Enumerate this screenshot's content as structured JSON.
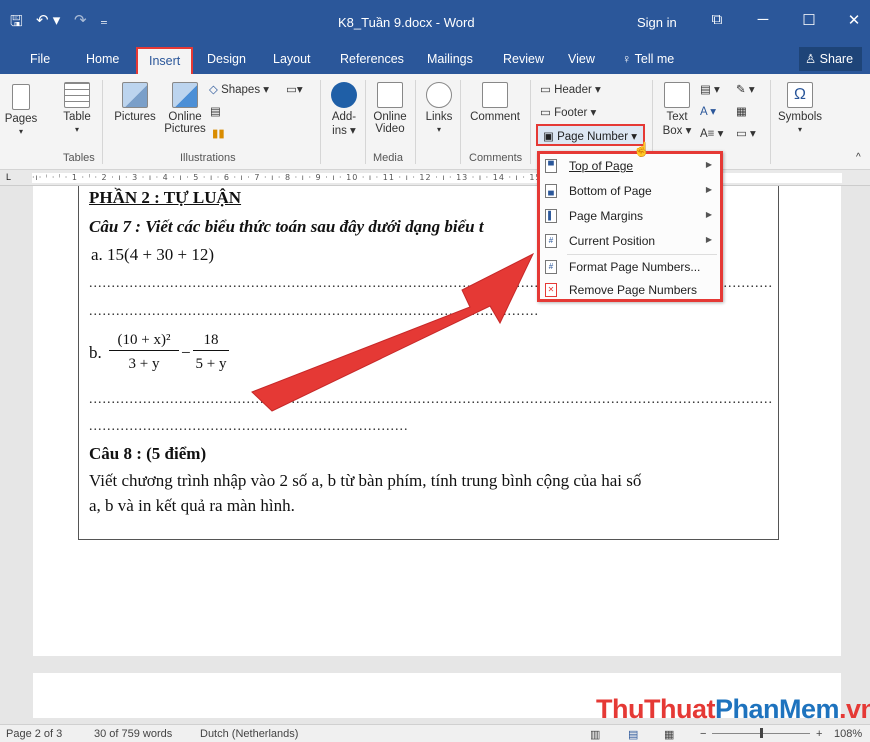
{
  "titlebar": {
    "doc_title": "K8_Tuần 9.docx  -  Word",
    "sign_in": "Sign in",
    "save_glyph": "🖫",
    "undo_glyph": "↶ ▾",
    "redo_glyph": "↷",
    "customize_glyph": "₌",
    "ribbon_options_glyph": "⧉",
    "minimize_glyph": "─",
    "maximize_glyph": "☐",
    "close_glyph": "✕"
  },
  "tabs": {
    "file": "File",
    "home": "Home",
    "insert": "Insert",
    "design": "Design",
    "layout": "Layout",
    "references": "References",
    "mailings": "Mailings",
    "review": "Review",
    "view": "View",
    "tell_me": "♀ Tell me",
    "share": "♙ Share"
  },
  "ribbon": {
    "pages": "Pages",
    "table": "Table",
    "pictures": "Pictures",
    "online_pictures_1": "Online",
    "online_pictures_2": "Pictures",
    "shapes": "Shapes ▾",
    "addins_1": "Add-",
    "addins_2": "ins ▾",
    "online_video_1": "Online",
    "online_video_2": "Video",
    "links": "Links",
    "comment": "Comment",
    "header": "Header ▾",
    "footer": "Footer ▾",
    "page_number": "Page Number ▾",
    "text_box_1": "Text",
    "text_box_2": "Box ▾",
    "symbols": "Symbols",
    "groups": {
      "tables": "Tables",
      "illustrations": "Illustrations",
      "media": "Media",
      "comments": "Comments"
    }
  },
  "ruler": {
    "scale": "·ı· ⁱ · ˡ · 1 · ˡ · 2 · ı · 3 · ı · 4 · ı · 5 · ı · 6 · ı · 7 · ı · 8 · ı · 9 · ı · 10 · ı · 11 · ı · 12 · ı · 13 · ı · 14 · ı · 15 · ı · 16 · ı · 17 · ı · 18 ·"
  },
  "document": {
    "heading": "PHẦN 2 : TỰ LUẬN",
    "q7": "Câu 7 : Viết các biểu thức toán sau đây dưới dạng biểu t",
    "a": "a. 15(4 + 30 + 12)",
    "dots_long": "....................................................................................................................................................................",
    "dots_short": ".......................................................................................................",
    "b_label": "b.",
    "b_num": "(10 + x)²",
    "b_den": "3 + y",
    "b_minus": "−",
    "b_num2": "18",
    "b_den2": "5 + y",
    "q8": "Câu 8 : (5 điểm)",
    "q8_line1": "Viết chương trình nhập vào 2 số a, b từ bàn phím, tính trung bình cộng của hai số",
    "q8_line2": "a, b và in kết quả ra màn hình."
  },
  "dropdown": {
    "items": [
      {
        "label": "Top of Page",
        "submenu": true
      },
      {
        "label": "Bottom of Page",
        "submenu": true
      },
      {
        "label": "Page Margins",
        "submenu": true
      },
      {
        "label": "Current Position",
        "submenu": true
      },
      {
        "label": "Format Page Numbers...",
        "submenu": false
      },
      {
        "label": "Remove Page Numbers",
        "submenu": false
      }
    ]
  },
  "status": {
    "page": "Page 2 of 3",
    "words": "30 of 759 words",
    "language": "Dutch (Netherlands)",
    "zoom": "108%"
  },
  "watermark": {
    "part1": "ThuThuat",
    "part2": "PhanMem",
    "part3": ".vn"
  },
  "colors": {
    "word_blue": "#2b579a",
    "highlight_red": "#e53935",
    "arrow_red": "#e53935"
  }
}
